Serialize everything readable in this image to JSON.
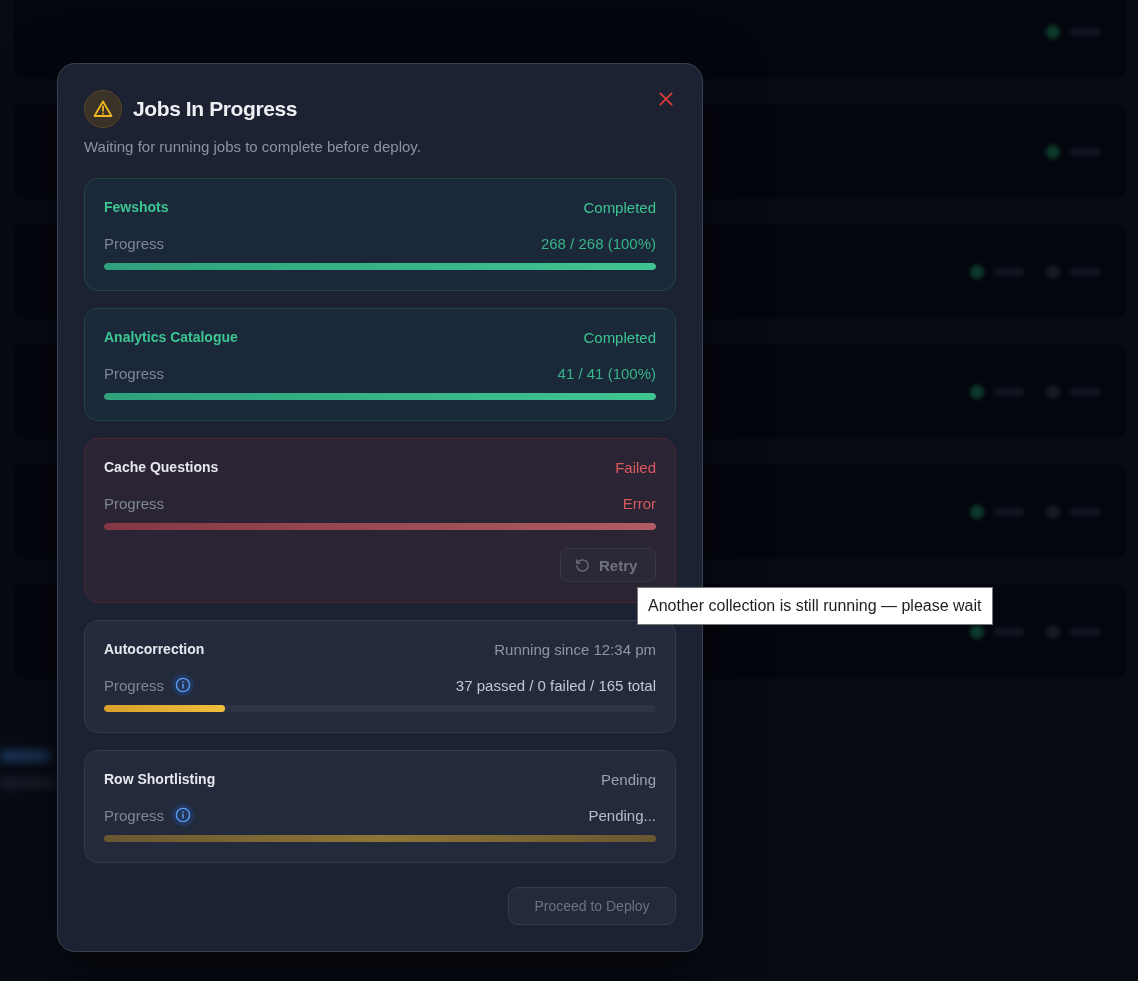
{
  "dialog": {
    "title": "Jobs In Progress",
    "subtitle": "Waiting for running jobs to complete before deploy."
  },
  "jobs": [
    {
      "name": "Fewshots",
      "kind": "completed",
      "status": "Completed",
      "progress_label": "Progress",
      "info_icon": false,
      "reading": "268 / 268 (100%)",
      "level": 1
    },
    {
      "name": "Analytics Catalogue",
      "kind": "completed",
      "status": "Completed",
      "progress_label": "Progress",
      "info_icon": false,
      "reading": "41 / 41 (100%)",
      "level": 1
    },
    {
      "name": "Cache Questions",
      "kind": "failed",
      "status": "Failed",
      "progress_label": "Progress",
      "info_icon": false,
      "reading": "Error",
      "level": 1,
      "retry": {
        "label": "Retry",
        "disabled": true,
        "tooltip": "Another collection is still running — please wait"
      }
    },
    {
      "name": "Autocorrection",
      "kind": "running",
      "status": "Running since 12:34 pm",
      "progress_label": "Progress",
      "info_icon": true,
      "reading": "37 passed / 0 failed / 165 total",
      "level": 0.22
    },
    {
      "name": "Row Shortlisting",
      "kind": "pending",
      "status": "Pending",
      "progress_label": "Progress",
      "info_icon": true,
      "reading": "Pending..."
    }
  ],
  "deploy_button": {
    "label": "Proceed to Deploy",
    "disabled": true
  }
}
